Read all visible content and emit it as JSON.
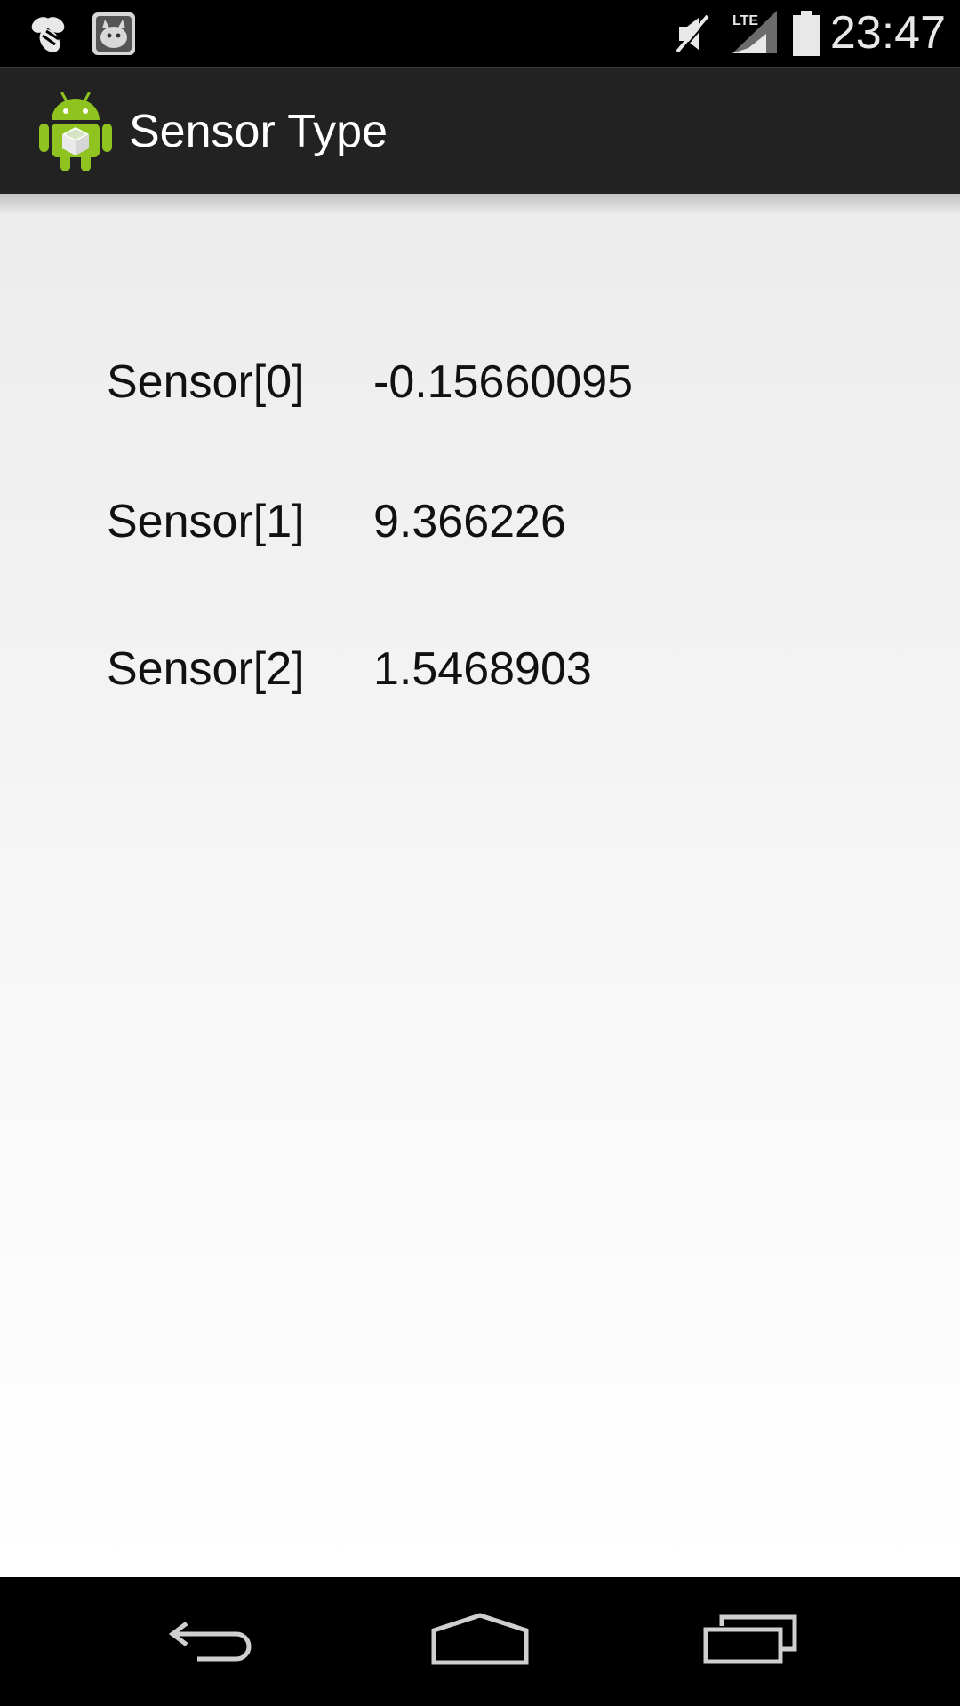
{
  "status_bar": {
    "time": "23:47",
    "icons": [
      "swarm-bee-icon",
      "cat-app-icon",
      "mute-icon",
      "lte-signal-icon",
      "battery-icon"
    ],
    "network_label": "LTE"
  },
  "action_bar": {
    "title": "Sensor Type",
    "icon": "android-app-icon"
  },
  "sensors": [
    {
      "label": "Sensor[0]",
      "value": "-0.15660095"
    },
    {
      "label": "Sensor[1]",
      "value": "9.366226"
    },
    {
      "label": "Sensor[2]",
      "value": "1.5468903"
    }
  ],
  "nav_bar": {
    "buttons": [
      "back-icon",
      "home-icon",
      "recents-icon"
    ]
  },
  "colors": {
    "status_bar_bg": "#000000",
    "action_bar_bg": "#222222",
    "content_bg_top": "#ececec",
    "content_bg_bottom": "#ffffff",
    "android_green": "#8fc31f"
  }
}
